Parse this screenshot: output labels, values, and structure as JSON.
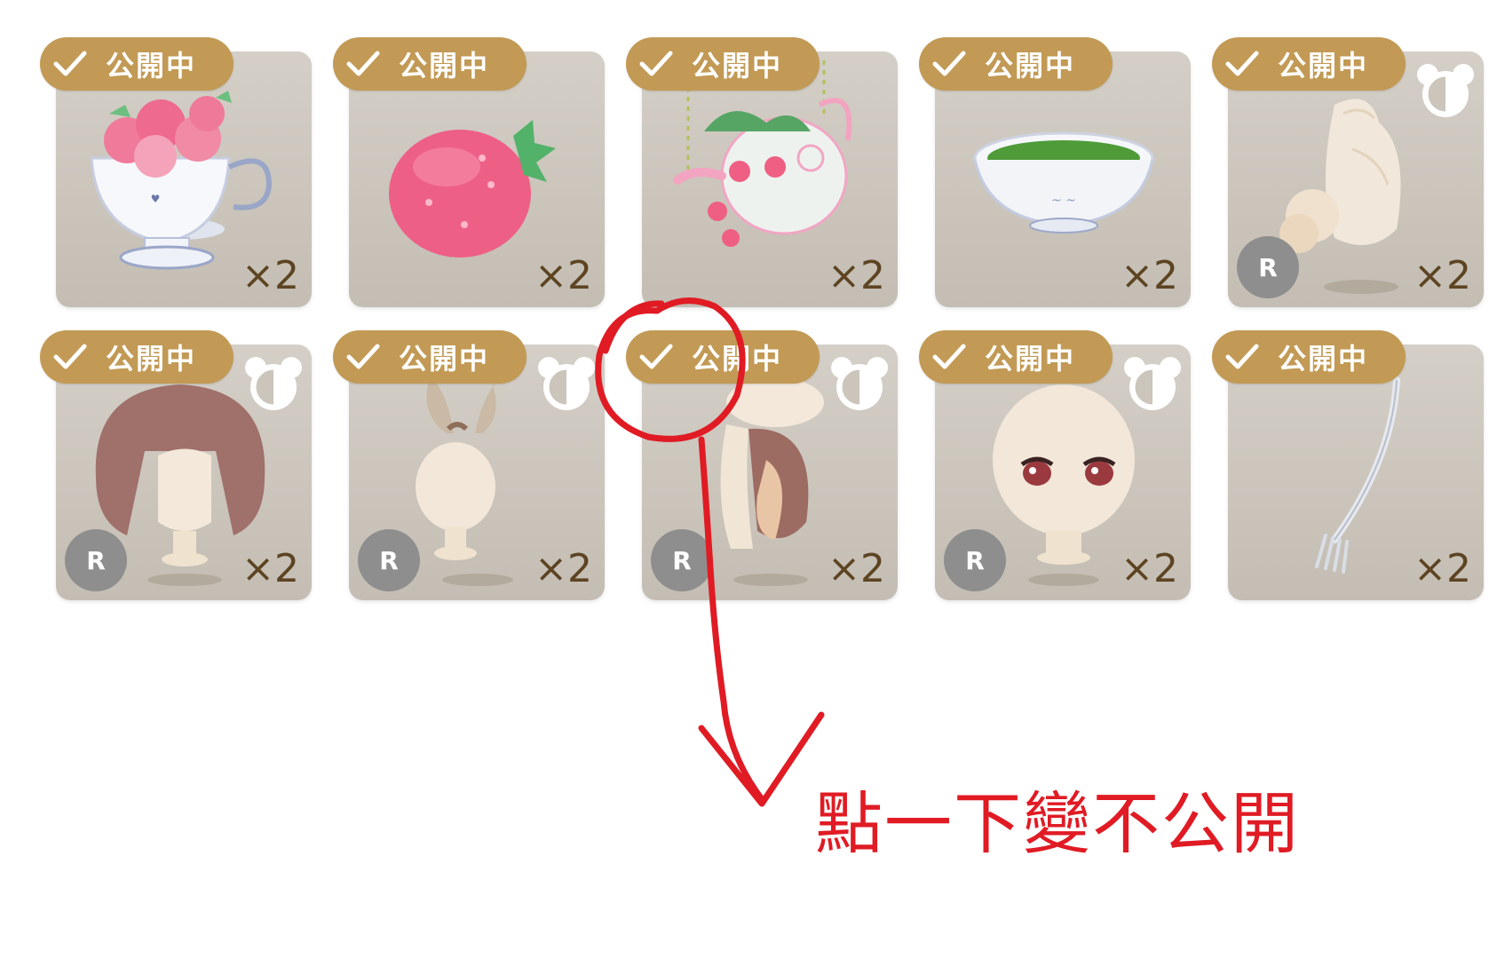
{
  "items": [
    {
      "name": "strawberry-teacup",
      "badge": "公開中",
      "qty": "×2",
      "rarity": "",
      "bear": false
    },
    {
      "name": "strawberry",
      "badge": "公開中",
      "qty": "×2",
      "rarity": "",
      "bear": false
    },
    {
      "name": "strawberry-teapot",
      "badge": "公開中",
      "qty": "×2",
      "rarity": "",
      "bear": false
    },
    {
      "name": "green-soup-bowl",
      "badge": "公開中",
      "qty": "×2",
      "rarity": "",
      "bear": false
    },
    {
      "name": "hair-bun-item",
      "badge": "公開中",
      "qty": "×2",
      "rarity": "R",
      "bear": true
    },
    {
      "name": "brown-bob-hair",
      "badge": "公開中",
      "qty": "×2",
      "rarity": "R",
      "bear": true
    },
    {
      "name": "bunny-ears",
      "badge": "公開中",
      "qty": "×2",
      "rarity": "R",
      "bear": true
    },
    {
      "name": "twin-tail-hair",
      "badge": "公開中",
      "qty": "×2",
      "rarity": "R",
      "bear": true
    },
    {
      "name": "eyes-face",
      "badge": "公開中",
      "qty": "×2",
      "rarity": "R",
      "bear": true
    },
    {
      "name": "silver-fork",
      "badge": "公開中",
      "qty": "×2",
      "rarity": "",
      "bear": false
    }
  ],
  "annotation": {
    "note": "點一下變不公開"
  },
  "colors": {
    "badge": "#c29a55",
    "card": "#cbc5bc",
    "annotation": "#e01b24",
    "qty": "#5d4422"
  }
}
